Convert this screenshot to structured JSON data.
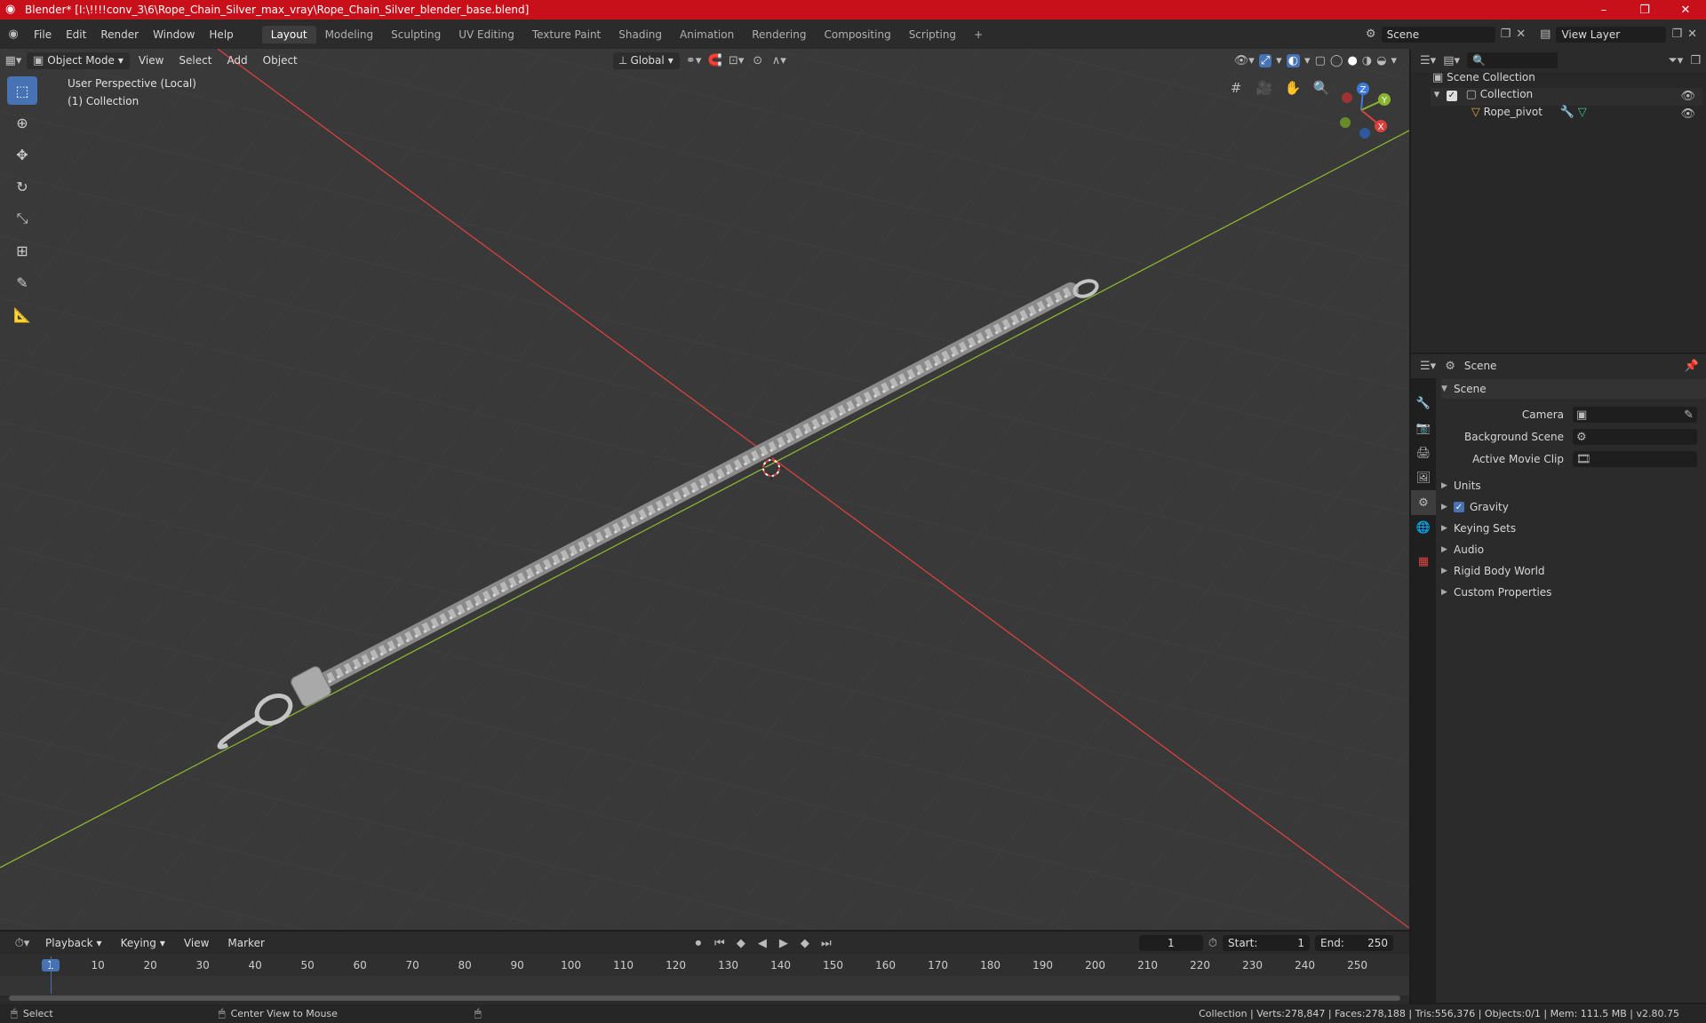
{
  "window": {
    "title": "Blender* [I:\\!!!!conv_3\\6\\Rope_Chain_Silver_max_vray\\Rope_Chain_Silver_blender_base.blend]",
    "minimize": "–",
    "maximize": "❐",
    "close": "✕"
  },
  "menu": [
    "File",
    "Edit",
    "Render",
    "Window",
    "Help"
  ],
  "workspaces": [
    "Layout",
    "Modeling",
    "Sculpting",
    "UV Editing",
    "Texture Paint",
    "Shading",
    "Animation",
    "Rendering",
    "Compositing",
    "Scripting"
  ],
  "workspace_add": "+",
  "scene_field": "Scene",
  "view_layer_field": "View Layer",
  "viewport": {
    "mode": "Object Mode",
    "menus": [
      "View",
      "Select",
      "Add",
      "Object"
    ],
    "transform": "Global",
    "overlay_title": "User Perspective (Local)",
    "overlay_collection": "(1) Collection",
    "gizmo": {
      "z": "Z",
      "y": "Y",
      "x": "X"
    }
  },
  "outliner": {
    "root": "Scene Collection",
    "collection": "Collection",
    "object": "Rope_pivot"
  },
  "properties": {
    "header": "Scene",
    "panel": "Scene",
    "labels": {
      "camera": "Camera",
      "background": "Background Scene",
      "clip": "Active Movie Clip"
    },
    "subpanels": [
      "Units",
      "Gravity",
      "Keying Sets",
      "Audio",
      "Rigid Body World",
      "Custom Properties"
    ]
  },
  "timeline": {
    "menus": [
      "Playback",
      "Keying",
      "View",
      "Marker"
    ],
    "current_frame": "1",
    "start_label": "Start:",
    "start": "1",
    "end_label": "End:",
    "end": "250",
    "ticks": [
      "1",
      "10",
      "20",
      "30",
      "40",
      "50",
      "60",
      "70",
      "80",
      "90",
      "100",
      "110",
      "120",
      "130",
      "140",
      "150",
      "160",
      "170",
      "180",
      "190",
      "200",
      "210",
      "220",
      "230",
      "240",
      "250"
    ]
  },
  "status": {
    "select": "Select",
    "center": "Center View to Mouse",
    "stats": "Collection | Verts:278,847 | Faces:278,188 | Tris:556,376 | Objects:0/1 | Mem: 111.5 MB | v2.80.75"
  },
  "colors": {
    "title_bar": "#c8101a",
    "accent": "#4772b3",
    "x_axis": "#d9413f",
    "y_axis": "#8ab42e"
  }
}
